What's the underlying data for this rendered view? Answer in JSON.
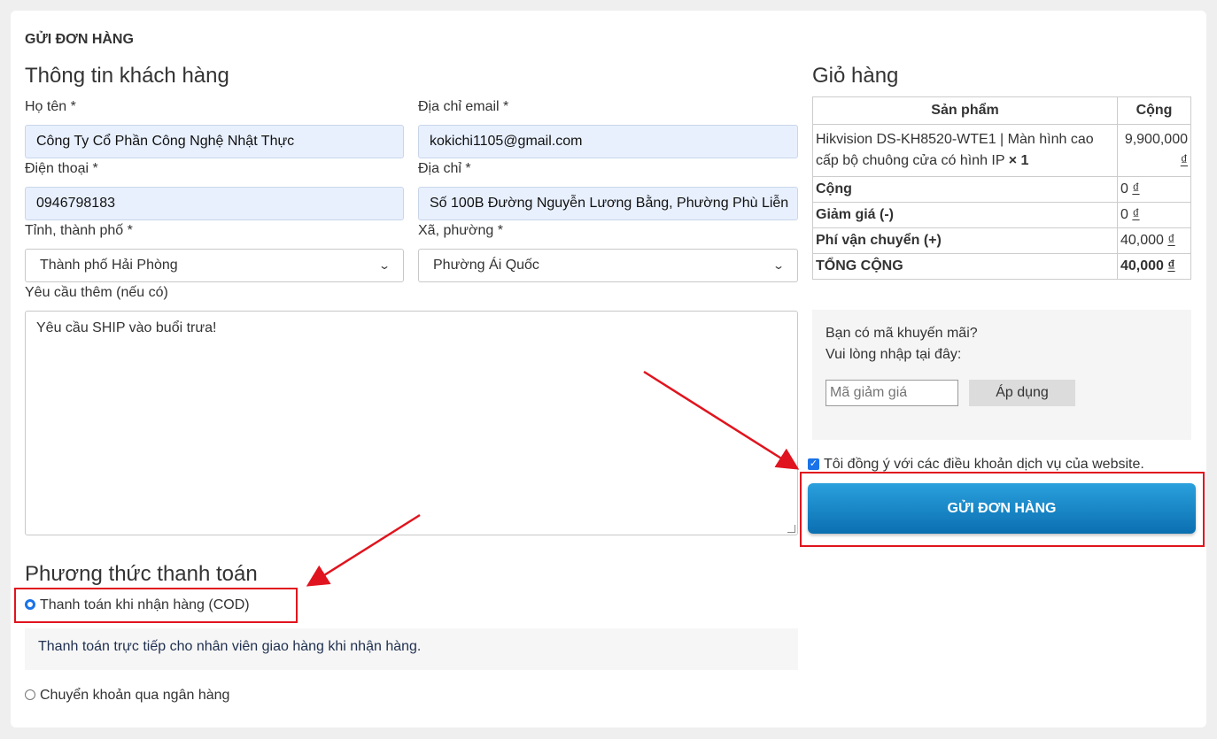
{
  "page_title": "GỬI ĐƠN HÀNG",
  "customer": {
    "heading": "Thông tin khách hàng",
    "name_label": "Họ tên *",
    "name_value": "Công Ty Cổ Phần Công Nghệ Nhật Thực",
    "email_label": "Địa chỉ email *",
    "email_value": "kokichi1105@gmail.com",
    "phone_label": "Điện thoại *",
    "phone_value": "0946798183",
    "address_label": "Địa chỉ *",
    "address_value": "Số 100B Đường Nguyễn Lương Bằng, Phường Phù Liễn",
    "province_label": "Tỉnh, thành phố *",
    "province_value": "Thành phố Hải Phòng",
    "ward_label": "Xã, phường *",
    "ward_value": "Phường Ái Quốc",
    "notes_label": "Yêu cầu thêm (nếu có)",
    "notes_value": "Yêu cầu SHIP vào buổi trưa!"
  },
  "cart": {
    "heading": "Giỏ hàng",
    "col_product": "Sản phẩm",
    "col_total": "Cộng",
    "item_name": "Hikvision DS-KH8520-WTE1 | Màn hình cao cấp bộ chuông cửa có hình IP",
    "item_qty": "× 1",
    "item_price": "9,900,000",
    "currency": "₫",
    "subtotal_label": "Cộng",
    "subtotal_value": "0",
    "discount_label": "Giảm giá (-)",
    "discount_value": "0",
    "shipping_label": "Phí vận chuyển (+)",
    "shipping_value": "40,000",
    "total_label": "TỔNG CỘNG",
    "total_value": "40,000"
  },
  "promo": {
    "line1": "Bạn có mã khuyến mãi?",
    "line2": "Vui lòng nhập tại đây:",
    "placeholder": "Mã giảm giá",
    "apply_label": "Áp dụng"
  },
  "terms_label": "Tôi đồng ý với các điều khoản dịch vụ của website.",
  "submit_label": "GỬI ĐƠN HÀNG",
  "payment": {
    "heading": "Phương thức thanh toán",
    "cod_label": "Thanh toán khi nhận hàng (COD)",
    "cod_desc": "Thanh toán trực tiếp cho nhân viên giao hàng khi nhận hàng.",
    "bank_label": "Chuyển khoản qua ngân hàng"
  },
  "colors": {
    "accent": "#1a73e8",
    "button": "#0b7dc4",
    "highlight": "#e0141e"
  }
}
